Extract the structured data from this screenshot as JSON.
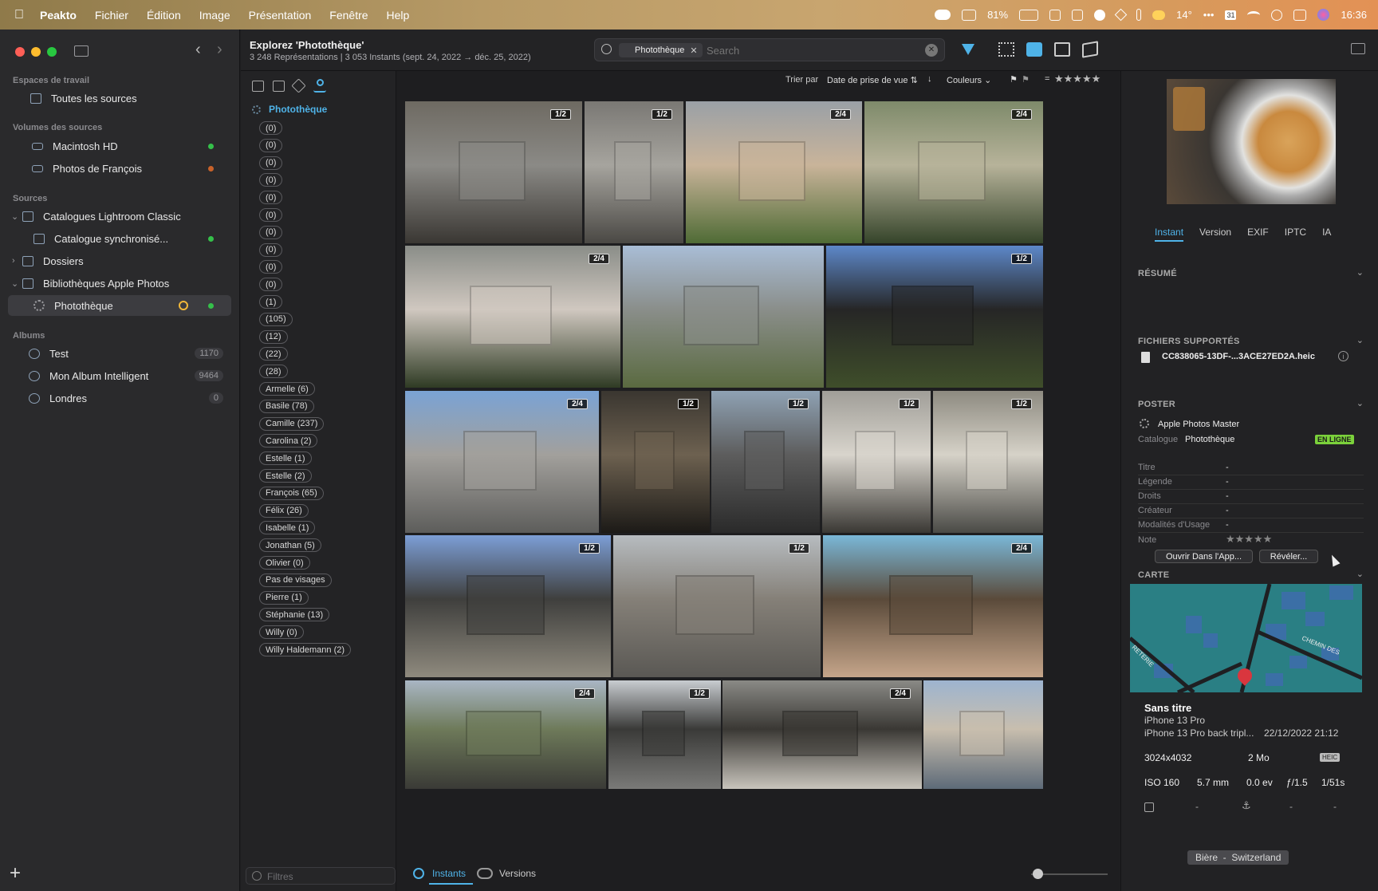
{
  "menubar": {
    "apple": "",
    "app": "Peakto",
    "items": [
      "Fichier",
      "Édition",
      "Image",
      "Présentation",
      "Fenêtre",
      "Help"
    ],
    "battery": "81%",
    "weather": "14°",
    "clock": "16:36",
    "calendar_day": "31"
  },
  "sidebar": {
    "workspaces_header": "Espaces de travail",
    "all_sources": "Toutes les sources",
    "volumes_header": "Volumes des sources",
    "volumes": [
      {
        "label": "Macintosh HD",
        "status": "#35c04a"
      },
      {
        "label": "Photos de François",
        "status": "#c8622a"
      }
    ],
    "sources_header": "Sources",
    "lr_catalogs": "Catalogues Lightroom Classic",
    "lr_sync": "Catalogue synchronisé...",
    "folders": "Dossiers",
    "apple_libs": "Bibliothèques Apple Photos",
    "phototheque": "Photothèque",
    "albums_header": "Albums",
    "albums": [
      {
        "label": "Test",
        "count": "1170"
      },
      {
        "label": "Mon Album Intelligent",
        "count": "9464"
      },
      {
        "label": "Londres",
        "count": "0"
      }
    ]
  },
  "header": {
    "title": "Explorez 'Photothèque'",
    "subtitle": "3 248 Représentations | 3 053 Instants (sept. 24, 2022 → déc. 25, 2022)"
  },
  "search": {
    "token": "Photothèque",
    "placeholder": "Search"
  },
  "sortbar": {
    "sort_label": "Trier par",
    "sort_value": "Date de prise de vue",
    "color_label": "Couleurs",
    "rating_eq": "="
  },
  "filter_panel": {
    "root": "Photothèque",
    "chips": [
      "(0)",
      "(0)",
      "(0)",
      "(0)",
      "(0)",
      "(0)",
      "(0)",
      "(0)",
      "(0)",
      "(0)",
      "(1)",
      "(105)",
      "(12)",
      "(22)",
      "(28)",
      "Armelle (6)",
      "Basile (78)",
      "Camille (237)",
      "Carolina (2)",
      "Estelle (1)",
      "Estelle (2)",
      "François (65)",
      "Félix (26)",
      "Isabelle (1)",
      "Jonathan (5)",
      "Olivier (0)",
      "Pas de visages",
      "Pierre (1)",
      "Stéphanie (13)",
      "Willy (0)",
      "Willy Haldemann (2)"
    ],
    "filter_placeholder": "Filtres"
  },
  "photos": [
    {
      "badge": "1/2",
      "colors": [
        "#6e6a62",
        "#3a3733",
        "#8b8a86"
      ]
    },
    {
      "badge": "1/2",
      "colors": [
        "#7a7874",
        "#4a4844",
        "#a6a49e"
      ]
    },
    {
      "badge": "2/4",
      "colors": [
        "#9aa0a6",
        "#4f6b35",
        "#c9b49a"
      ]
    },
    {
      "badge": "2/4",
      "colors": [
        "#7e8a6a",
        "#35442a",
        "#b7b39a"
      ]
    },
    {
      "badge": "2/4",
      "colors": [
        "#8a8d88",
        "#2f3b24",
        "#d0c8c0"
      ]
    },
    {
      "badge": "",
      "colors": [
        "#a9bdd6",
        "#5a6a40",
        "#8a8e8a"
      ]
    },
    {
      "badge": "1/2",
      "colors": [
        "#5d88c9",
        "#3f4e2a",
        "#262626"
      ]
    },
    {
      "badge": "2/4",
      "colors": [
        "#7aa3d5",
        "#5d5d5b",
        "#a2a09c"
      ]
    },
    {
      "badge": "1/2",
      "colors": [
        "#3a3630",
        "#1c1a17",
        "#6d6150"
      ]
    },
    {
      "badge": "1/2",
      "colors": [
        "#8fa2b4",
        "#2a2a2a",
        "#5d5d5d"
      ]
    },
    {
      "badge": "1/2",
      "colors": [
        "#a09e98",
        "#3a3834",
        "#d8d4cc"
      ]
    },
    {
      "badge": "1/2",
      "colors": [
        "#8d8a80",
        "#4a4a46",
        "#d6d2c8"
      ]
    },
    {
      "badge": "1/2",
      "colors": [
        "#7c9ed6",
        "#8f8a7e",
        "#3f3f3d"
      ]
    },
    {
      "badge": "1/2",
      "colors": [
        "#b7bcc0",
        "#5a5854",
        "#858078"
      ]
    },
    {
      "badge": "2/4",
      "colors": [
        "#7ab8d8",
        "#c5a58a",
        "#5a4a3a"
      ]
    },
    {
      "badge": "2/4",
      "colors": [
        "#a9b6c4",
        "#3a3a36",
        "#6e7a5a"
      ]
    },
    {
      "badge": "1/2",
      "colors": [
        "#c8ccd0",
        "#7a7a78",
        "#3a3a38"
      ]
    },
    {
      "badge": "2/4",
      "colors": [
        "#8a8a86",
        "#c8c4bc",
        "#3a3834"
      ]
    },
    {
      "badge": "",
      "colors": [
        "#9db4cf",
        "#5d6a78",
        "#c8beae"
      ]
    }
  ],
  "bottom_tabs": {
    "instants": "Instants",
    "versions": "Versions"
  },
  "inspector": {
    "tabs": [
      "Instant",
      "Version",
      "EXIF",
      "IPTC",
      "IA"
    ],
    "resume": "RÉSUMÉ",
    "files_header": "FICHIERS SUPPORTÉS",
    "file_name": "CC838065-13DF-...3ACE27ED2A.heic",
    "poster_header": "POSTER",
    "poster_source": "Apple Photos Master",
    "catalog_label": "Catalogue",
    "catalog_value": "Photothèque",
    "online_badge": "EN LIGNE",
    "rows": [
      {
        "k": "Titre",
        "v": "-"
      },
      {
        "k": "Légende",
        "v": "-"
      },
      {
        "k": "Droits",
        "v": "-"
      },
      {
        "k": "Créateur",
        "v": "-"
      },
      {
        "k": "Modalités d'Usage",
        "v": "-"
      }
    ],
    "note_label": "Note",
    "open_btn": "Ouvrir Dans l'App...",
    "reveal_btn": "Révéler...",
    "map_header": "CARTE",
    "map_street1": "CHEMIN DES",
    "map_street2": "RETERIE",
    "card": {
      "title": "Sans titre",
      "device": "iPhone 13 Pro",
      "lens": "iPhone 13 Pro back tripl...",
      "date": "22/12/2022 21:12",
      "dims": "3024x4032",
      "size": "2 Mo",
      "fmt": "HEIC",
      "iso": "ISO 160",
      "focal": "5.7 mm",
      "ev": "0.0 ev",
      "aperture": "ƒ/1.5",
      "shutter": "1/51s",
      "dash1": "-",
      "dash2": "-",
      "dash3": "-",
      "location": "Bière  -  Switzerland"
    }
  },
  "colors": {
    "accent": "#4fb3e8",
    "online": "#7bd13b",
    "pin": "#d9363e",
    "map_bg": "#2a7f84",
    "map_block": "#3b6fa6"
  }
}
